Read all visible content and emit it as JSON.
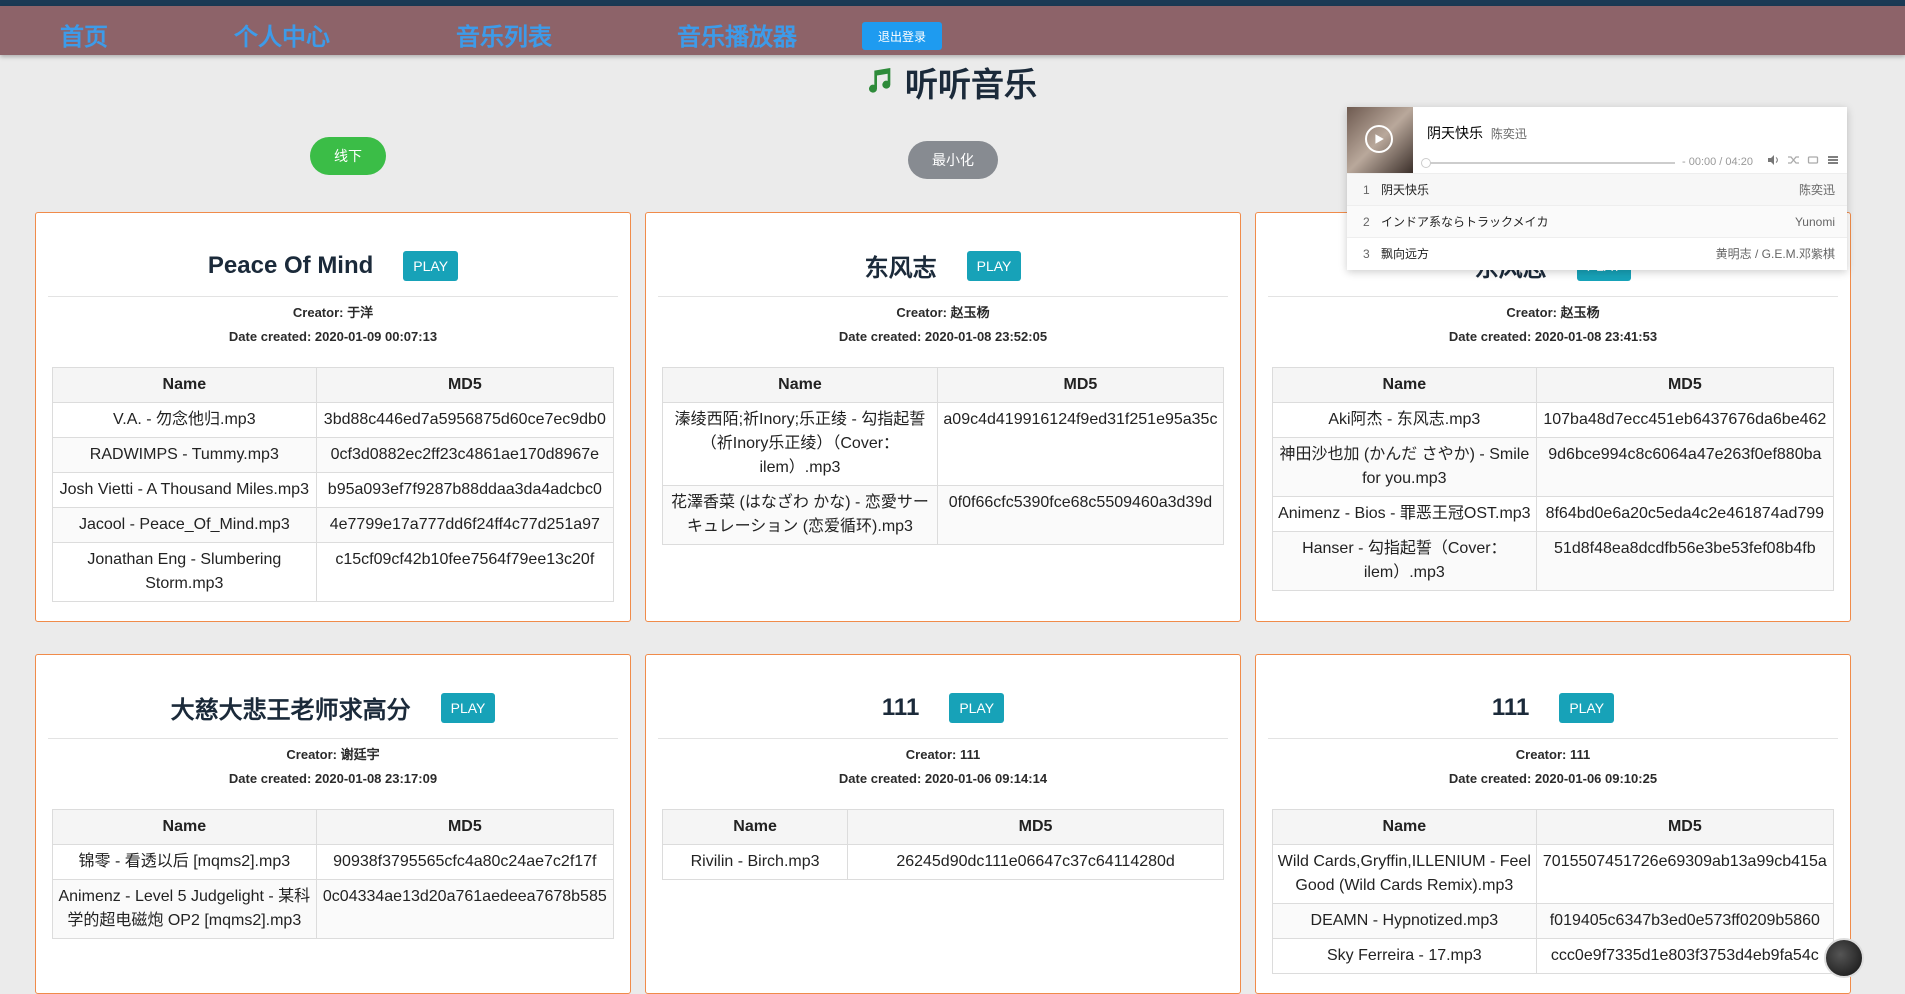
{
  "nav": {
    "home": "首页",
    "profile": "个人中心",
    "music_list": "音乐列表",
    "music_player": "音乐播放器",
    "logout": "退出登录"
  },
  "site_title": "听听音乐",
  "buttons": {
    "offline": "线下",
    "minimize": "最小化"
  },
  "labels": {
    "creator": "Creator: ",
    "date_created": "Date created: ",
    "play": "PLAY",
    "col_name": "Name",
    "col_md5": "MD5"
  },
  "player": {
    "title": "阴天快乐",
    "artist": "陈奕迅",
    "time": "- 00:00 / 04:20",
    "progress": 0,
    "playlist": [
      {
        "index": "1",
        "name": "阴天快乐",
        "artist": "陈奕迅"
      },
      {
        "index": "2",
        "name": "インドア系ならトラックメイカ",
        "artist": "Yunomi"
      },
      {
        "index": "3",
        "name": "飘向远方",
        "artist": "黄明志 / G.E.M.邓紫棋"
      }
    ]
  },
  "playlists": [
    {
      "title": "Peace Of Mind",
      "creator": "于洋",
      "date": "2020-01-09 00:07:13",
      "songs": [
        {
          "name": "V.A. - 勿念他归.mp3",
          "md5": "3bd88c446ed7a5956875d60ce7ec9db0"
        },
        {
          "name": "RADWIMPS - Tummy.mp3",
          "md5": "0cf3d0882ec2ff23c4861ae170d8967e"
        },
        {
          "name": "Josh Vietti - A Thousand Miles.mp3",
          "md5": "b95a093ef7f9287b88ddaa3da4adcbc0"
        },
        {
          "name": "Jacool - Peace_Of_Mind.mp3",
          "md5": "4e7799e17a777dd6f24ff4c77d251a97"
        },
        {
          "name": "Jonathan Eng - Slumbering Storm.mp3",
          "md5": "c15cf09cf42b10fee7564f79ee13c20f"
        }
      ]
    },
    {
      "title": "东风志",
      "creator": "赵玉杨",
      "date": "2020-01-08 23:52:05",
      "songs": [
        {
          "name": "溱绫西陌;祈Inory;乐正绫 - 勾指起誓（祈Inory乐正绫）（Cover：ilem）.mp3",
          "md5": "a09c4d419916124f9ed31f251e95a35c"
        },
        {
          "name": "花澤香菜 (はなざわ かな) - 恋愛サーキュレーション (恋爱循环).mp3",
          "md5": "0f0f66cfc5390fce68c5509460a3d39d"
        }
      ]
    },
    {
      "title": "东风志",
      "creator": "赵玉杨",
      "date": "2020-01-08 23:41:53",
      "songs": [
        {
          "name": "Aki阿杰 - 东风志.mp3",
          "md5": "107ba48d7ecc451eb6437676da6be462"
        },
        {
          "name": "神田沙也加 (かんだ さやか) - Smile for you.mp3",
          "md5": "9d6bce994c8c6064a47e263f0ef880ba"
        },
        {
          "name": "Animenz - Bios - 罪恶王冠OST.mp3",
          "md5": "8f64bd0e6a20c5eda4c2e461874ad799"
        },
        {
          "name": "Hanser - 勾指起誓（Cover：ilem）.mp3",
          "md5": "51d8f48ea8dcdfb56e3be53fef08b4fb"
        }
      ]
    },
    {
      "title": "大慈大悲王老师求高分",
      "creator": "谢廷宇",
      "date": "2020-01-08 23:17:09",
      "songs": [
        {
          "name": "锦零 - 看透以后 [mqms2].mp3",
          "md5": "90938f3795565cfc4a80c24ae7c2f17f"
        },
        {
          "name": "Animenz - Level 5 Judgelight - 某科学的超电磁炮 OP2 [mqms2].mp3",
          "md5": "0c04334ae13d20a761aedeea7678b585"
        }
      ]
    },
    {
      "title": "111",
      "creator": "111",
      "date": "2020-01-06 09:14:14",
      "songs": [
        {
          "name": "Rivilin - Birch.mp3",
          "md5": "26245d90dc111e06647c37c64114280d"
        }
      ]
    },
    {
      "title": "111",
      "creator": "111",
      "date": "2020-01-06 09:10:25",
      "songs": [
        {
          "name": "Wild Cards,Gryffin,ILLENIUM - Feel Good (Wild Cards Remix).mp3",
          "md5": "7015507451726e69309ab13a99cb415a"
        },
        {
          "name": "DEAMN - Hypnotized.mp3",
          "md5": "f019405c6347b3ed0e573ff0209b5860"
        },
        {
          "name": "Sky Ferreira - 17.mp3",
          "md5": "ccc0e9f7335d1e803f3753d4eb9fa54c"
        }
      ]
    }
  ],
  "colors": {
    "nav_bg": "#8d6369",
    "nav_link": "#3d9be9",
    "card_border": "#f08b4a",
    "play_btn": "#17a2b8",
    "offline_btn": "#3bbd47"
  },
  "icons": {
    "title": "music-note-icon",
    "player_play": "play-circle-icon",
    "volume": "volume-icon",
    "shuffle": "shuffle-icon",
    "loop": "loop-icon",
    "menu": "menu-icon"
  }
}
